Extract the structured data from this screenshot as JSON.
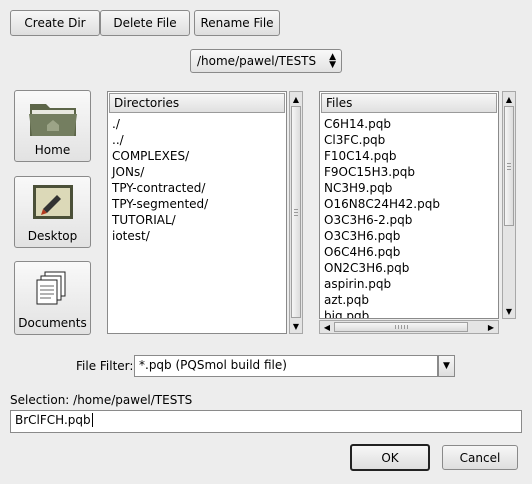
{
  "toolbar": {
    "create_dir": "Create Dir",
    "delete_file": "Delete File",
    "rename_file": "Rename File"
  },
  "path_combo": {
    "value": "/home/pawel/TESTS"
  },
  "places": [
    {
      "label": "Home",
      "icon": "home-folder-icon"
    },
    {
      "label": "Desktop",
      "icon": "desktop-icon"
    },
    {
      "label": "Documents",
      "icon": "documents-icon"
    }
  ],
  "directories": {
    "header": "Directories",
    "items": [
      "./",
      "../",
      "COMPLEXES/",
      "JONs/",
      "TPY-contracted/",
      "TPY-segmented/",
      "TUTORIAL/",
      "iotest/"
    ]
  },
  "files": {
    "header": "Files",
    "items": [
      "C6H14.pqb",
      "Cl3FC.pqb",
      "F10C14.pqb",
      "F9OC15H3.pqb",
      "NC3H9.pqb",
      "O16N8C24H42.pqb",
      "O3C3H6-2.pqb",
      "O3C3H6.pqb",
      "O6C4H6.pqb",
      "ON2C3H6.pqb",
      "aspirin.pqb",
      "azt.pqb",
      "big.pqb"
    ]
  },
  "filter": {
    "label": "File Filter:",
    "value": "*.pqb (PQSmol build file)"
  },
  "selection": {
    "label": "Selection: /home/pawel/TESTS",
    "value": "BrClFCH.pqb"
  },
  "dialog": {
    "ok": "OK",
    "cancel": "Cancel"
  },
  "colors": {
    "background": "#ededed",
    "folder": "#6f7a5a"
  }
}
